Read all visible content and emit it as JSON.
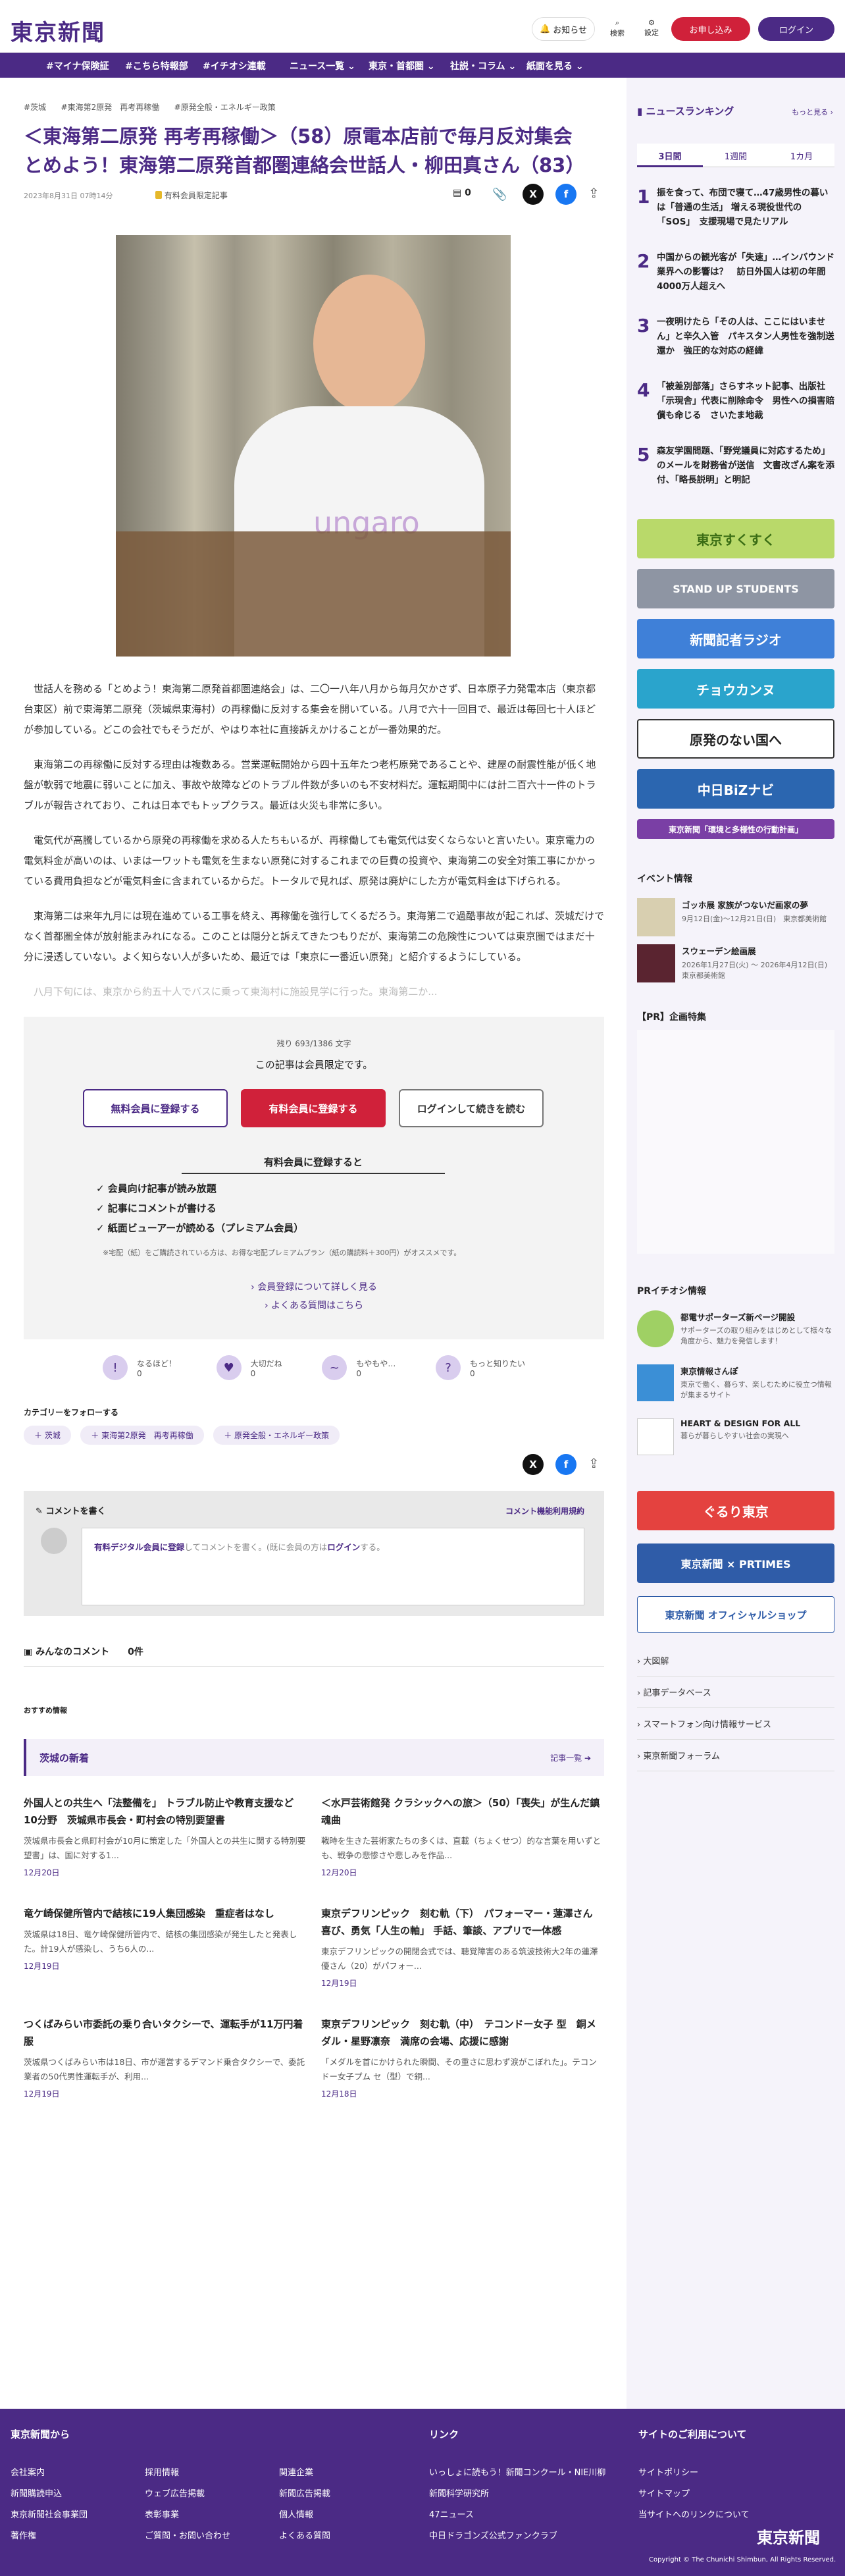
{
  "header": {
    "logo": "東京新聞",
    "notice": "お知らせ",
    "search": "検索",
    "settings": "設定",
    "subscribe": "お申し込み",
    "login": "ログイン"
  },
  "nav": [
    "#マイナ保険証",
    "#こちら特報部",
    "#イチオシ連載",
    "ニュース一覧 ⌄",
    "東京・首都圏 ⌄",
    "社説・コラム ⌄",
    "紙面を見る ⌄"
  ],
  "article": {
    "tags": [
      "#茨城",
      "#東海第2原発　再考再稼働",
      "#原発全般・エネルギー政策"
    ],
    "title": "＜東海第二原発 再考再稼働＞（58）原電本店前で毎月反対集会　とめよう！東海第二原発首都圏連絡会世話人・柳田真さん（83）",
    "date": "2023年8月31日 07時14分",
    "members_only": "有料会員限定記事",
    "comment_count": "0",
    "photo_text": "ungaro",
    "paragraphs": [
      "世話人を務める「とめよう！東海第二原発首都圏連絡会」は、二〇一八年八月から毎月欠かさず、日本原子力発電本店（東京都台東区）前で東海第二原発（茨城県東海村）の再稼働に反対する集会を開いている。八月で六十一回目で、最近は毎回七十人ほどが参加している。どこの会社でもそうだが、やはり本社に直接訴えかけることが一番効果的だ。",
      "東海第二の再稼働に反対する理由は複数ある。営業運転開始から四十五年たつ老朽原発であることや、建屋の耐震性能が低く地盤が軟弱で地震に弱いことに加え、事故や故障などのトラブル件数が多いのも不安材料だ。運転期間中には計二百六十一件のトラブルが報告されており、これは日本でもトップクラス。最近は火災も非常に多い。",
      "電気代が高騰しているから原発の再稼働を求める人たちもいるが、再稼働しても電気代は安くならないと言いたい。東京電力の電気料金が高いのは、いまは一ワットも電気を生まない原発に対するこれまでの巨費の投資や、東海第二の安全対策工事にかかっている費用負担などが電気料金に含まれているからだ。トータルで見れば、原発は廃炉にした方が電気料金は下げられる。",
      "東海第二は来年九月には現在進めている工事を終え、再稼働を強行してくるだろう。東海第二で過酷事故が起これば、茨城だけでなく首都圏全体が放射能まみれになる。このことは隠分と訴えてきたつもりだが、東海第二の危険性については東京圏ではまだ十分に浸透していない。よく知らない人が多いため、最近では「東京に一番近い原発」と紹介するようにしている。",
      "八月下旬には、東京から約五十人でバスに乗って東海村に施設見学に行った。東海第二か..."
    ]
  },
  "paywall": {
    "remaining": "残り 693/1386 文字",
    "notice": "この記事は会員限定です。",
    "free_btn": "無料会員に登録する",
    "paid_btn": "有料会員に登録する",
    "login_btn": "ログインして続きを読む",
    "benefit_title": "有料会員に登録すると",
    "benefits": [
      "会員向け記事が読み放題",
      "記事にコメントが書ける",
      "紙面ビューアーが読める（プレミアム会員）"
    ],
    "note": "※宅配（紙）をご購読されている方は、お得な宅配プレミアムプラン（紙の購読料＋300円）がオススメです。",
    "link1": "会員登録について詳しく見る",
    "link2": "よくある質問はこちら"
  },
  "reactions": [
    {
      "label": "なるほど！",
      "count": "0",
      "icon": "!"
    },
    {
      "label": "大切だね",
      "count": "0",
      "icon": "♥"
    },
    {
      "label": "もやもや…",
      "count": "0",
      "icon": "~"
    },
    {
      "label": "もっと知りたい",
      "count": "0",
      "icon": "?"
    }
  ],
  "follow": {
    "title": "カテゴリーをフォローする",
    "tags": [
      "＋ 茨城",
      "＋ 東海第2原発　再考再稼働",
      "＋ 原発全般・エネルギー政策"
    ]
  },
  "comments": {
    "write": "コメントを書く",
    "policy": "コメント機能利用規約",
    "prompt_link": "有料デジタル会員に登録",
    "prompt_mid": "してコメントを書く。(既に会員の方は",
    "prompt_login": "ログイン",
    "prompt_end": "する。",
    "all": "みんなのコメント",
    "all_count": "0件"
  },
  "recommend": {
    "label": "おすすめ情報",
    "section": "茨城の新着",
    "more": "記事一覧 ➔",
    "items": [
      {
        "title": "外国人との共生へ「法整備を」 トラブル防止や教育支援など10分野　茨城県市長会・町村会の特別要望書",
        "body": "茨城県市長会と県町村会が10月に策定した「外国人との共生に関する特別要望書」は、国に対する1...",
        "date": "12月20日"
      },
      {
        "title": "＜水戸芸術館発 クラシックへの旅＞（50）「喪失」が生んだ鎮魂曲",
        "body": "戦時を生きた芸術家たちの多くは、直載（ちょくせつ）的な言葉を用いずとも、戦争の悲惨さや悲しみを作品...",
        "date": "12月20日"
      },
      {
        "title": "竜ケ崎保健所管内で結核に19人集団感染　重症者はなし",
        "body": "茨城県は18日、竜ケ崎保健所管内で、結核の集団感染が発生したと発表した。計19人が感染し、うち6人の...",
        "date": "12月19日"
      },
      {
        "title": "東京デフリンピック　刻む軌（下）　パフォーマー・蓮澤さん　喜び、勇気「人生の軸」 手話、筆談、アプリで一体感",
        "body": "東京デフリンピックの開閉会式では、聴覚障害のある筑波技術大2年の蓮澤優さん（20）がパフォー...",
        "date": "12月19日"
      },
      {
        "title": "つくばみらい市委託の乗り合いタクシーで、運転手が11万円着服",
        "body": "茨城県つくばみらい市は18日、市が運営するデマンド乗合タクシーで、委託業者の50代男性運転手が、利用...",
        "date": "12月19日"
      },
      {
        "title": "東京デフリンピック　刻む軌（中）　テコンドー女子 型　銅メダル・星野凛奈　満席の会場、応援に感謝",
        "body": "「メダルを首にかけられた瞬間、その重さに思わず涙がこぼれた」。テコンドー女子プム セ（型）で銅...",
        "date": "12月18日"
      }
    ]
  },
  "sidebar": {
    "ranking_title": "ニュースランキング",
    "more": "もっと見る ›",
    "tabs": [
      "3日間",
      "1週間",
      "1カ月"
    ],
    "ranking": [
      "振を食って、布団で寝て…47歳男性の暮いは「普通の生活」 増える現役世代の「SOS」　支援現場で見たリアル",
      "中国からの観光客が「失速」…インバウンド業界への影響は？　訪日外国人は初の年間4000万人超えへ",
      "一夜明けたら「その人は、ここにはいません」と辛久入管　パキスタン人男性を強制送還か　強圧的な対応の経緯",
      "「被差別部落」さらすネット記事、出版社「示現舎」代表に削除命令　男性への損害賠償も命じる　さいたま地裁",
      "森友学園問題、「野党議員に対応するため」のメールを財務省が送信　文書改ざん案を添付、「略長説明」と明記"
    ],
    "banners": [
      {
        "text": "東京すくすく",
        "bg": "#b9d96a"
      },
      {
        "text": "STAND UP STUDENTS",
        "bg": "#8e95a3"
      },
      {
        "text": "新聞記者ラジオ",
        "bg": "#3f80d8"
      },
      {
        "text": "チョウカンヌ",
        "bg": "#2aa4cc"
      },
      {
        "text": "原発のない国へ",
        "bg": "#ffffff"
      },
      {
        "text": "中日BiZナビ",
        "bg": "#2b66b0"
      },
      {
        "text": "東京新聞「環境と多様性の行動計画」",
        "bg": "#7a3fa5"
      }
    ],
    "events_title": "イベント情報",
    "events": [
      {
        "title": "ゴッホ展 家族がつないだ画家の夢",
        "date": "9月12日(金)〜12月21日(日)　東京都美術館"
      },
      {
        "title": "スウェーデン絵画展",
        "date": "2026年1月27日(火) 〜 2026年4月12日(日)　東京都美術館"
      }
    ],
    "pr_title": "【PR】企画特集",
    "pr_info_title": "PRイチオシ情報",
    "pr_info": [
      {
        "title": "都電サポーターズ新ページ開設",
        "body": "サポーターズの取り組みをはじめとして様々な角度から、魅力を発信します！"
      },
      {
        "title": "東京情報さんぽ",
        "body": "東京で働く、暮らす、楽しむために役立つ情報が集まるサイト"
      },
      {
        "title": "HEART & DESIGN FOR ALL",
        "body": "暮らが暮らしやすい社会の実現へ"
      }
    ],
    "banners2": [
      {
        "text": "ぐるり東京",
        "bg": "#e4423f"
      },
      {
        "text": "東京新聞 × PRTIMES",
        "bg": "#2f5ca8"
      },
      {
        "text": "東京新聞 オフィシャルショップ",
        "bg": "#ffffff"
      }
    ],
    "links": [
      "大図解",
      "記事データベース",
      "スマートフォン向け情報サービス",
      "東京新聞フォーラム"
    ]
  },
  "footer": {
    "col1_title": "東京新聞から",
    "col1": [
      "会社案内",
      "採用情報",
      "関連企業",
      "新聞購読申込",
      "ウェブ広告掲載",
      "新聞広告掲載",
      "東京新聞社会事業団",
      "著作権",
      "表彰事業",
      "個人情報",
      "ご質問・お問い合わせ",
      "よくある質問"
    ],
    "col2_title": "リンク",
    "col2": [
      "いっしょに読もう！新聞コンクール・NIE川柳",
      "新聞科学研究所",
      "47ニュース",
      "中日ドラゴンズ公式ファンクラブ"
    ],
    "col3_title": "サイトのご利用について",
    "col3": [
      "サイトポリシー",
      "サイトマップ",
      "当サイトへのリンクについて"
    ],
    "logo": "東京新聞",
    "copyright": "Copyright © The Chunichi Shimbun, All Rights Reserved."
  },
  "colors": {
    "brand": "#4b2a85",
    "accent": "#d0213a"
  }
}
